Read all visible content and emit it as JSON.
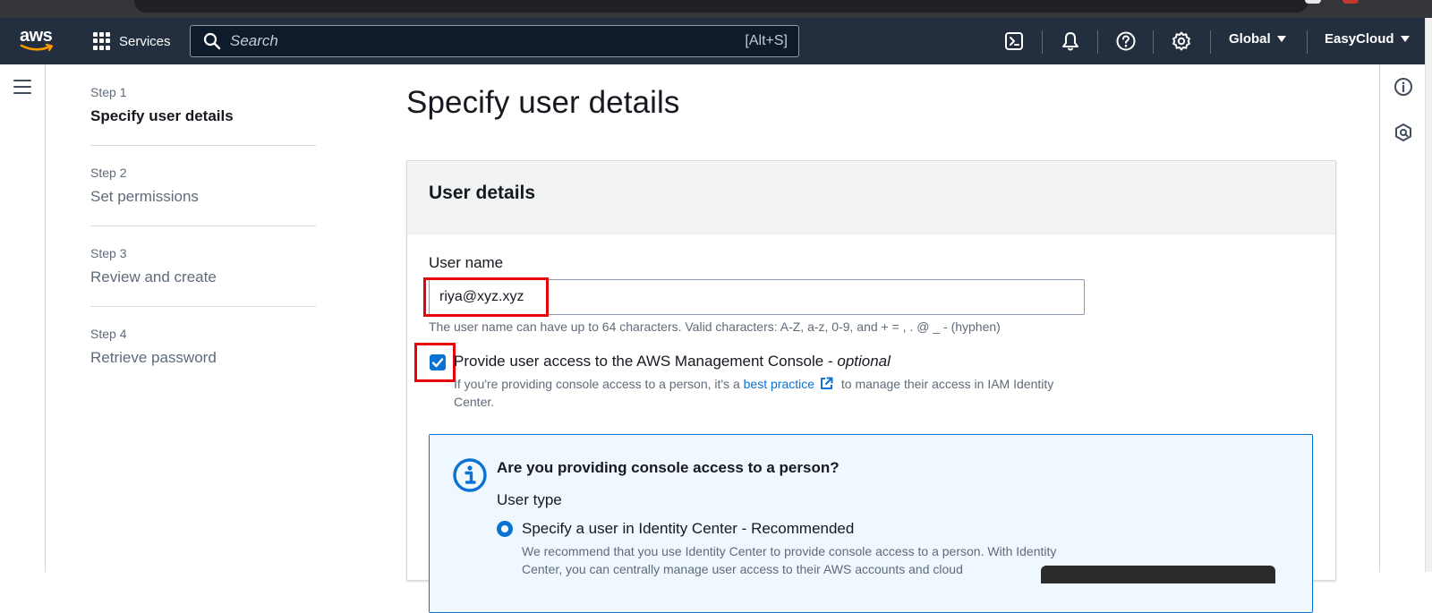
{
  "topnav": {
    "logo_text": "aws",
    "services_label": "Services",
    "search_placeholder": "Search",
    "search_shortcut": "[Alt+S]",
    "icons": [
      "cloudshell-icon",
      "bell-icon",
      "help-icon",
      "settings-icon"
    ],
    "region_label": "Global",
    "account_label": "EasyCloud"
  },
  "steps": [
    {
      "num": "Step 1",
      "name": "Specify user details"
    },
    {
      "num": "Step 2",
      "name": "Set permissions"
    },
    {
      "num": "Step 3",
      "name": "Review and create"
    },
    {
      "num": "Step 4",
      "name": "Retrieve password"
    }
  ],
  "page": {
    "title": "Specify user details"
  },
  "user_details": {
    "heading": "User details",
    "username_label": "User name",
    "username_value": "riya@xyz.xyz",
    "username_hint": "The user name can have up to 64 characters. Valid characters: A-Z, a-z, 0-9, and + = , . @ _ - (hyphen)",
    "console_access_label": "Provide user access to the AWS Management Console - ",
    "console_access_optional": "optional",
    "console_access_checked": true,
    "console_desc_before": "If you're providing console access to a person, it's a ",
    "console_desc_link": "best practice",
    "console_desc_after": " to manage their access in IAM Identity Center."
  },
  "info_box": {
    "title": "Are you providing console access to a person?",
    "user_type_label": "User type",
    "option_label": "Specify a user in Identity Center - Recommended",
    "option_selected": true,
    "option_desc": "We recommend that you use Identity Center to provide console access to a person. With Identity Center, you can centrally manage user access to their AWS accounts and cloud"
  },
  "colors": {
    "nav_bg": "#232f3e",
    "accent": "#0972d3",
    "highlight": "#e8000a"
  }
}
